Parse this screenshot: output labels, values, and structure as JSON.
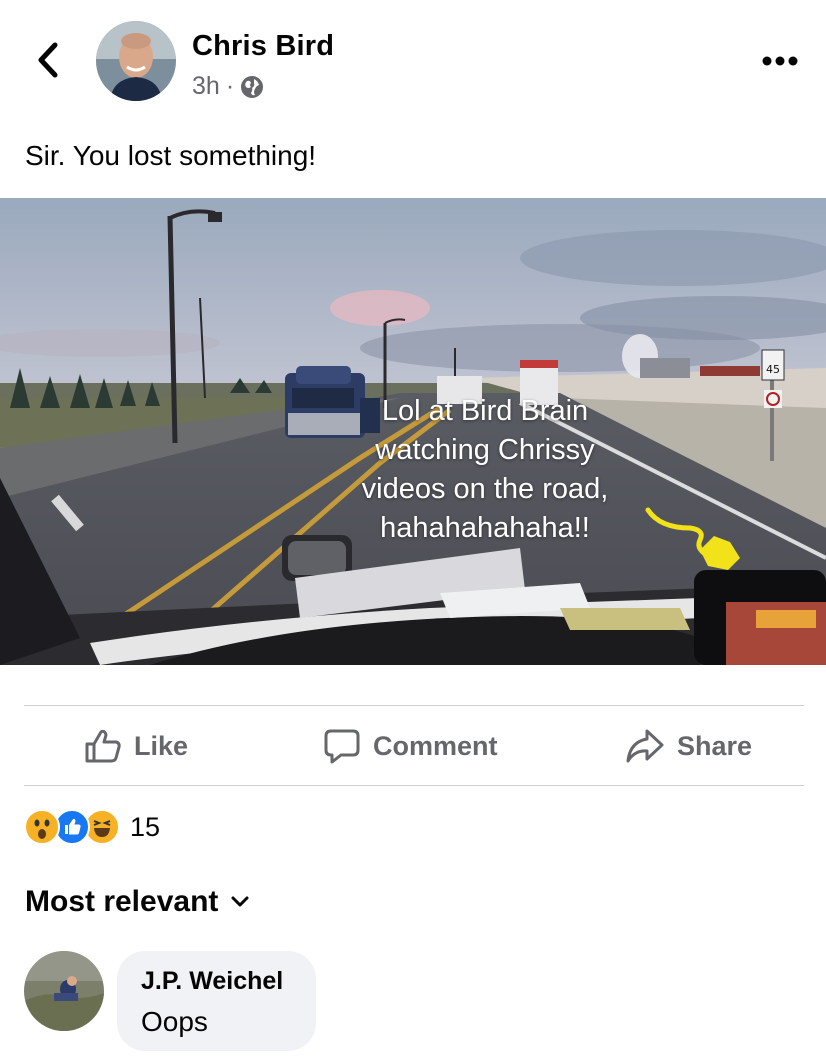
{
  "post": {
    "author": "Chris Bird",
    "time": "3h",
    "separator": "·",
    "privacy_icon": "globe-icon",
    "text": "Sir. You lost something!",
    "image_caption": "Lol at Bird Brain watching Chrissy videos on the road, hahahahahaha!!",
    "sign_speed": "45"
  },
  "actions": {
    "like": "Like",
    "comment": "Comment",
    "share": "Share"
  },
  "reactions": {
    "icons": [
      "wow-reaction-icon",
      "like-reaction-icon",
      "haha-reaction-icon"
    ],
    "count": "15"
  },
  "comments": {
    "sort_label": "Most relevant",
    "items": [
      {
        "author": "J.P. Weichel",
        "text": "Oops"
      }
    ]
  },
  "colors": {
    "text": "#050505",
    "secondary": "#65676b",
    "divider": "#ced0d4",
    "bubble": "#f0f2f5",
    "like_blue": "#1877f2",
    "reaction_yellow": "#f7b125"
  }
}
